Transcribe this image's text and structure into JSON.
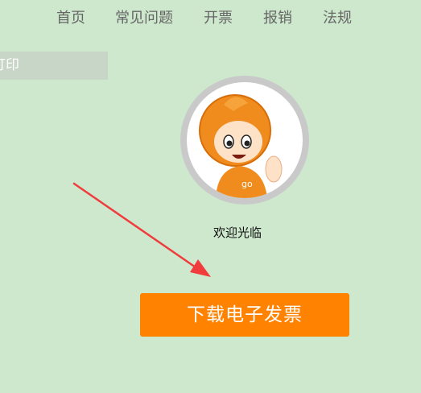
{
  "nav": {
    "items": [
      {
        "label": "首页"
      },
      {
        "label": "常见问题"
      },
      {
        "label": "开票"
      },
      {
        "label": "报销"
      },
      {
        "label": "法规"
      }
    ]
  },
  "sidebar": {
    "tab_label": "打印"
  },
  "profile": {
    "avatar_icon": "mascot-avatar-icon",
    "welcome_text": "欢迎光临"
  },
  "main": {
    "download_button_label": "下载电子发票"
  },
  "colors": {
    "background": "#cde8cd",
    "button": "#ff8200",
    "annotation_arrow": "#f03c3c"
  }
}
